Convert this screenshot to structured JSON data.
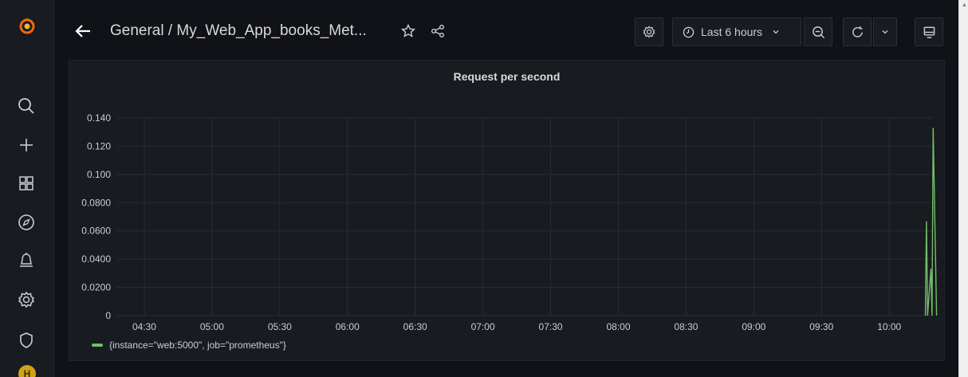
{
  "sidebar": {
    "items": [
      {
        "icon": "search-icon"
      },
      {
        "icon": "plus-icon"
      },
      {
        "icon": "dashboards-icon"
      },
      {
        "icon": "explore-compass-icon"
      },
      {
        "icon": "alerting-bell-icon"
      },
      {
        "icon": "configuration-gear-icon"
      },
      {
        "icon": "server-admin-shield-icon"
      }
    ],
    "avatar_letter": "H"
  },
  "header": {
    "breadcrumb": "General / My_Web_App_books_Met...",
    "time_range": "Last 6 hours"
  },
  "panel": {
    "title": "Request per second"
  },
  "colors": {
    "series": "#73bf69",
    "accent": "#f46800"
  },
  "chart_data": {
    "type": "line",
    "title": "Request per second",
    "xlabel": "",
    "ylabel": "",
    "x_ticks": [
      "04:30",
      "05:00",
      "05:30",
      "06:00",
      "06:30",
      "07:00",
      "07:30",
      "08:00",
      "08:30",
      "09:00",
      "09:30",
      "10:00"
    ],
    "y_ticks": [
      "0",
      "0.0200",
      "0.0400",
      "0.0600",
      "0.0800",
      "0.100",
      "0.120",
      "0.140"
    ],
    "ylim": [
      0,
      0.14
    ],
    "xlim": [
      "04:18",
      "10:19"
    ],
    "grid": true,
    "legend": "bottom-left",
    "series": [
      {
        "name": "{instance=\"web:5000\", job=\"prometheus\"}",
        "color": "#73bf69",
        "points": [
          {
            "x": "10:16",
            "y": 0
          },
          {
            "x": "10:16",
            "y": 0.0667
          },
          {
            "x": "10:16",
            "y": 0
          },
          {
            "x": "10:17",
            "y": 0.0333
          },
          {
            "x": "10:17",
            "y": 0
          },
          {
            "x": "10:17",
            "y": 0.133
          },
          {
            "x": "10:18",
            "y": 0
          }
        ]
      }
    ]
  }
}
